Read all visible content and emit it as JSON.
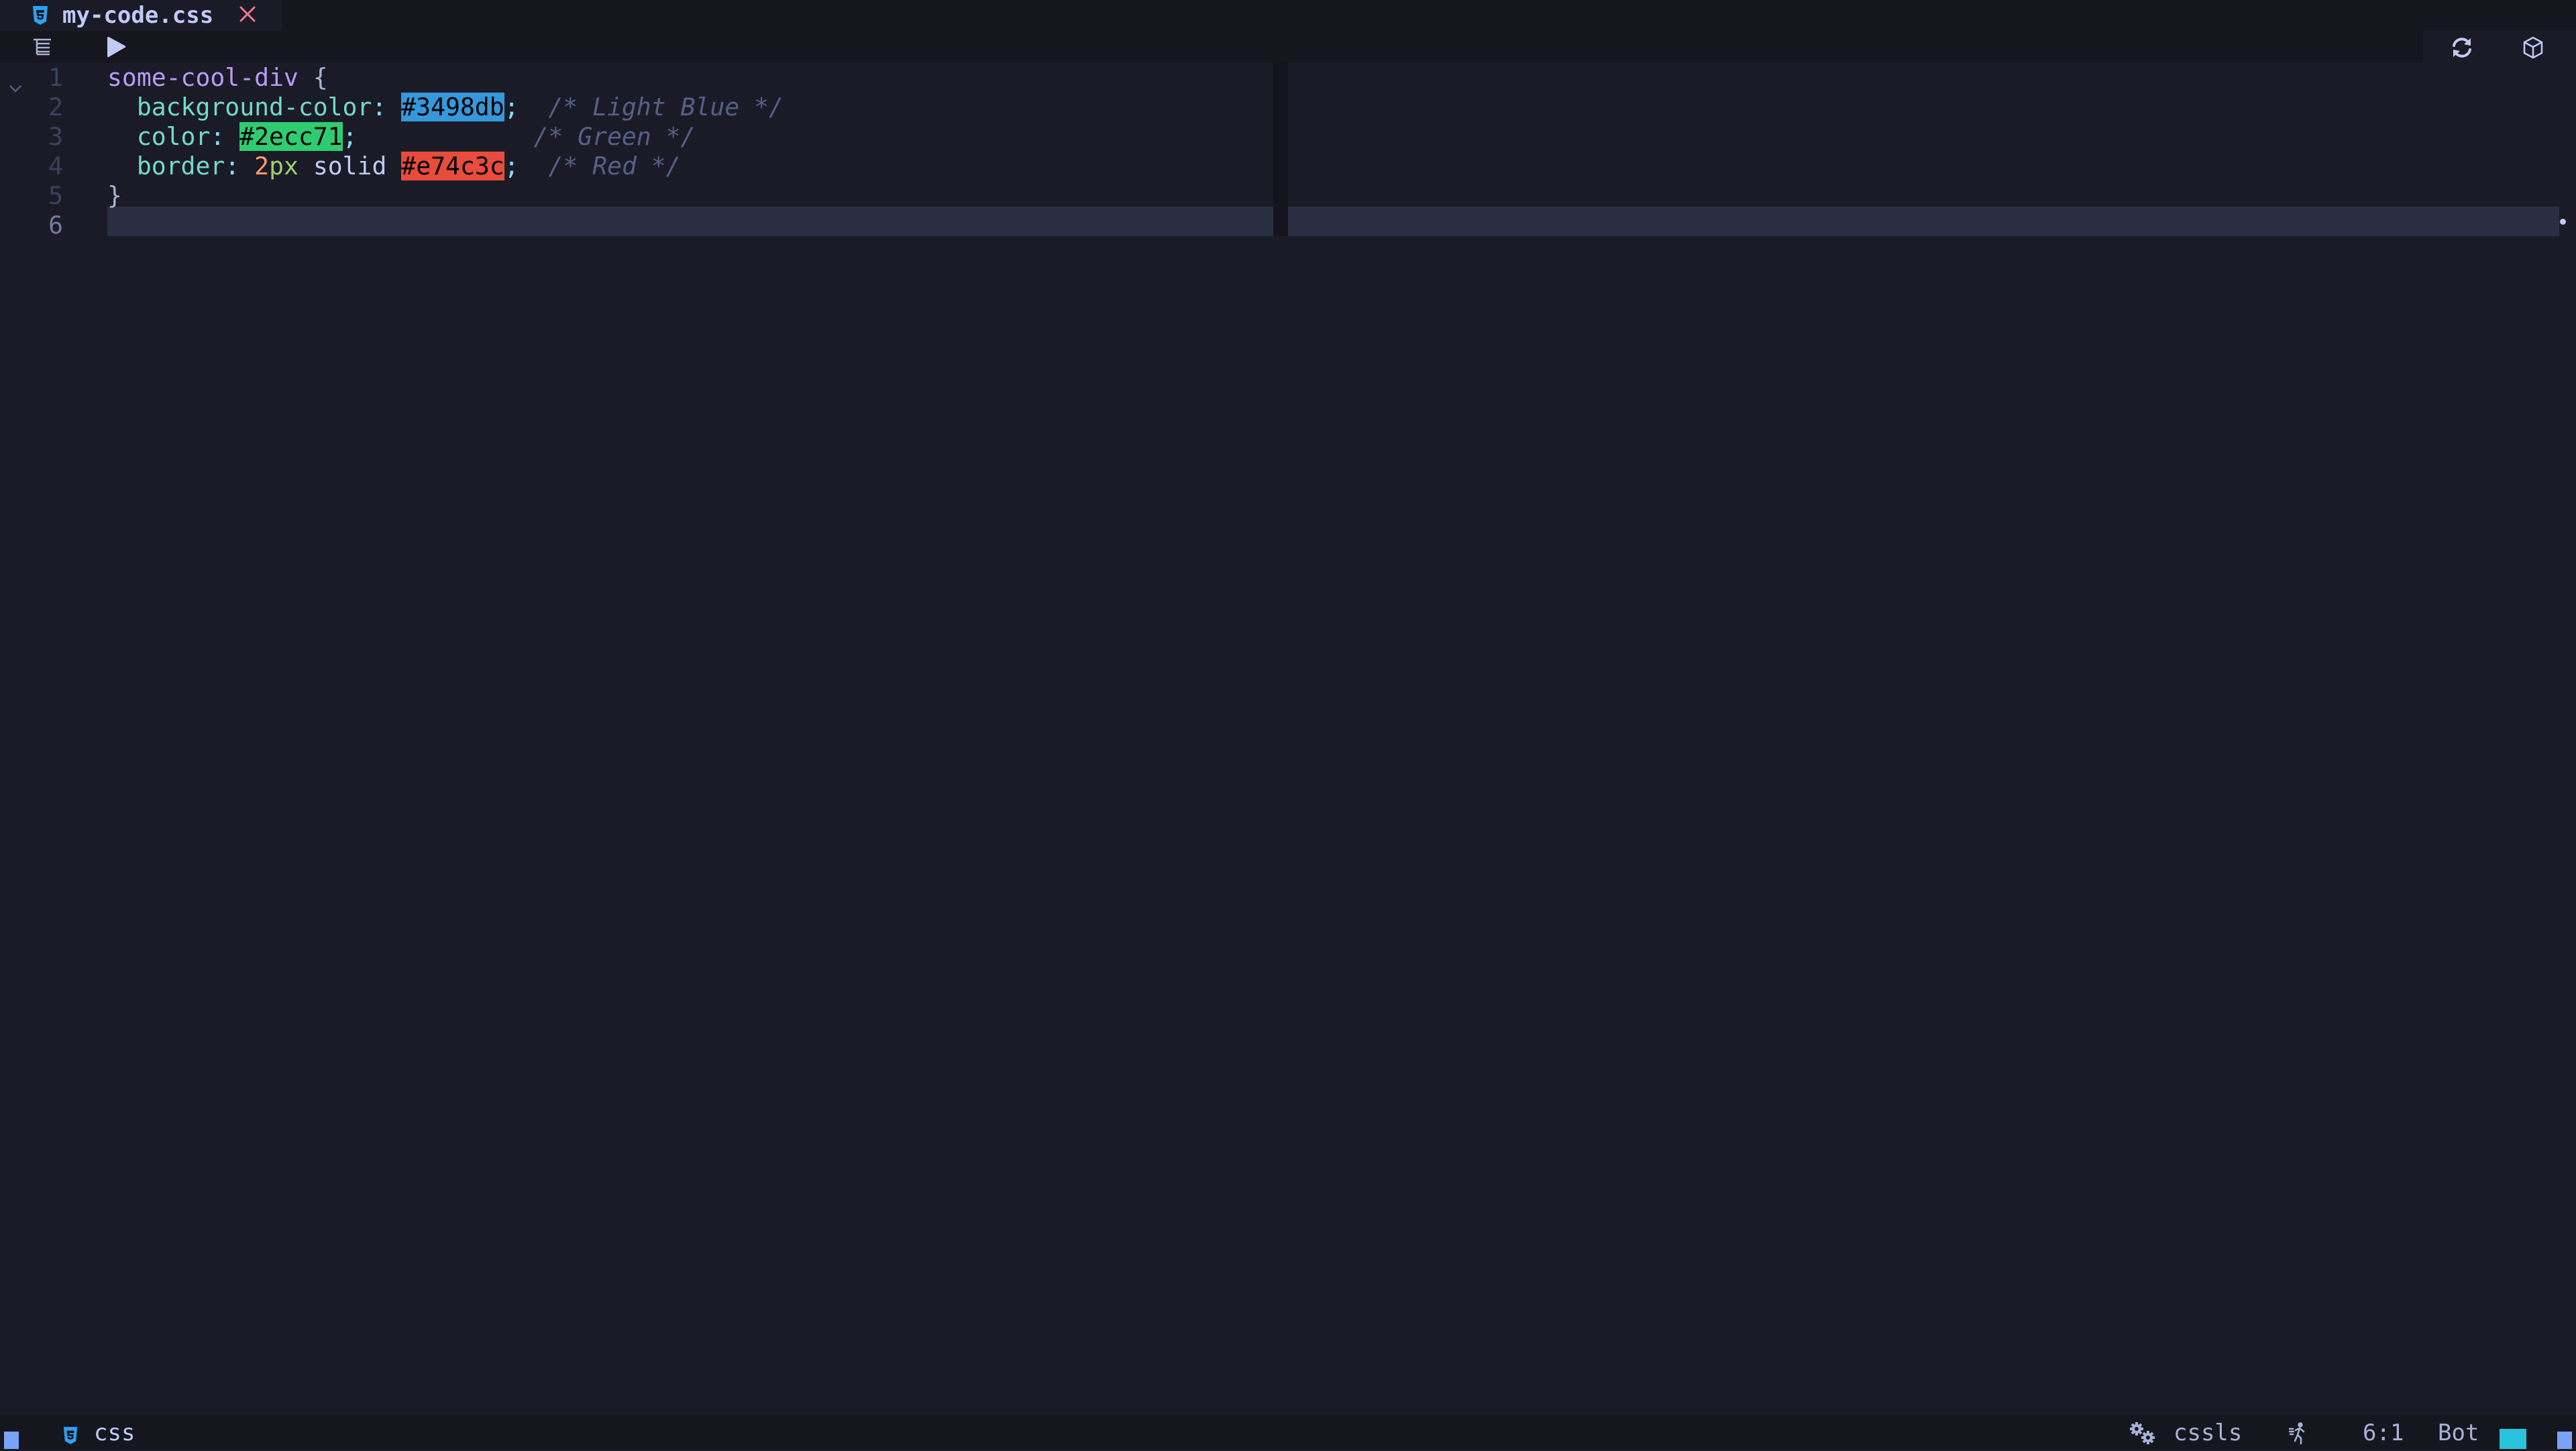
{
  "tabs": [
    {
      "label": "my-code.css",
      "icon": "css3-icon",
      "active": true,
      "close_icon": "close-icon"
    }
  ],
  "toolbar": {
    "left_icons": [
      "outline-icon",
      "run-icon"
    ],
    "right_icons": [
      "refresh-icon",
      "cube-icon"
    ]
  },
  "editor": {
    "language": "css",
    "cursor_line": 6,
    "lines": [
      {
        "number": "1",
        "foldable": true,
        "tokens": [
          {
            "t": "some-cool-div",
            "c": "sel"
          },
          {
            "t": " ",
            "c": ""
          },
          {
            "t": "{",
            "c": "brace"
          }
        ]
      },
      {
        "number": "2",
        "tokens": [
          {
            "t": "  ",
            "c": ""
          },
          {
            "t": "background-color",
            "c": "prop"
          },
          {
            "t": ":",
            "c": "punct"
          },
          {
            "t": " ",
            "c": ""
          },
          {
            "t": "#3498db",
            "c": "swatch",
            "bg": "#3498db"
          },
          {
            "t": ";",
            "c": "punct"
          },
          {
            "t": "  ",
            "c": ""
          },
          {
            "t": "/* Light Blue */",
            "c": "cmt"
          }
        ]
      },
      {
        "number": "3",
        "tokens": [
          {
            "t": "  ",
            "c": ""
          },
          {
            "t": "color",
            "c": "prop"
          },
          {
            "t": ":",
            "c": "punct"
          },
          {
            "t": " ",
            "c": ""
          },
          {
            "t": "#2ecc71",
            "c": "swatch",
            "bg": "#2ecc71"
          },
          {
            "t": ";",
            "c": "punct"
          },
          {
            "t": "            ",
            "c": ""
          },
          {
            "t": "/* Green */",
            "c": "cmt"
          }
        ]
      },
      {
        "number": "4",
        "tokens": [
          {
            "t": "  ",
            "c": ""
          },
          {
            "t": "border",
            "c": "prop"
          },
          {
            "t": ":",
            "c": "punct"
          },
          {
            "t": " ",
            "c": ""
          },
          {
            "t": "2",
            "c": "num"
          },
          {
            "t": "px",
            "c": "unit"
          },
          {
            "t": " ",
            "c": ""
          },
          {
            "t": "solid",
            "c": "kw"
          },
          {
            "t": " ",
            "c": ""
          },
          {
            "t": "#e74c3c",
            "c": "swatch",
            "bg": "#e74c3c"
          },
          {
            "t": ";",
            "c": "punct"
          },
          {
            "t": "  ",
            "c": ""
          },
          {
            "t": "/* Red */",
            "c": "cmt"
          }
        ]
      },
      {
        "number": "5",
        "tokens": [
          {
            "t": "}",
            "c": "brace"
          }
        ]
      },
      {
        "number": "6",
        "tokens": []
      }
    ]
  },
  "statusbar": {
    "filetype_icon": "css3-icon",
    "filetype": "css",
    "lsp_icon": "gears-icon",
    "lsp": "cssls",
    "activity_icon": "running-man-icon",
    "position": "6:1",
    "progress": "Bot"
  },
  "colors": {
    "background": "#1a1b26",
    "bar": "#16161e",
    "cursorline": "#292e42",
    "accent": "#7aa2f7",
    "progress_block": "#2ac3de",
    "css_icon": "#2ea1f2",
    "close": "#f7768e"
  }
}
